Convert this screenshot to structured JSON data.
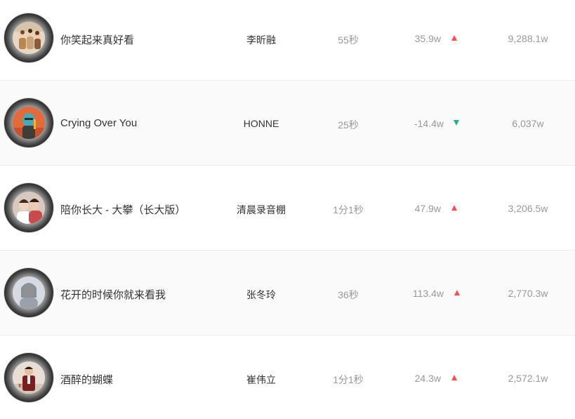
{
  "colors": {
    "up": "#ff4d4f",
    "down": "#1ab394",
    "text": "#333333",
    "muted": "#999999"
  },
  "rows": [
    {
      "title": "你笑起来真好看",
      "artist": "李昕融",
      "duration": "55秒",
      "change": "35.9w",
      "trend": "up",
      "plays": "9,288.1w"
    },
    {
      "title": "Crying Over You",
      "artist": "HONNE",
      "duration": "25秒",
      "change": "-14.4w",
      "trend": "down",
      "plays": "6,037w"
    },
    {
      "title": "陪你长大 - 大攀（长大版）",
      "artist": "清晨录音棚",
      "duration": "1分1秒",
      "change": "47.9w",
      "trend": "up",
      "plays": "3,206.5w"
    },
    {
      "title": "花开的时候你就来看我",
      "artist": "张冬玲",
      "duration": "36秒",
      "change": "113.4w",
      "trend": "up",
      "plays": "2,770.3w"
    },
    {
      "title": "酒醉的蝴蝶",
      "artist": "崔伟立",
      "duration": "1分1秒",
      "change": "24.3w",
      "trend": "up",
      "plays": "2,572.1w"
    }
  ]
}
